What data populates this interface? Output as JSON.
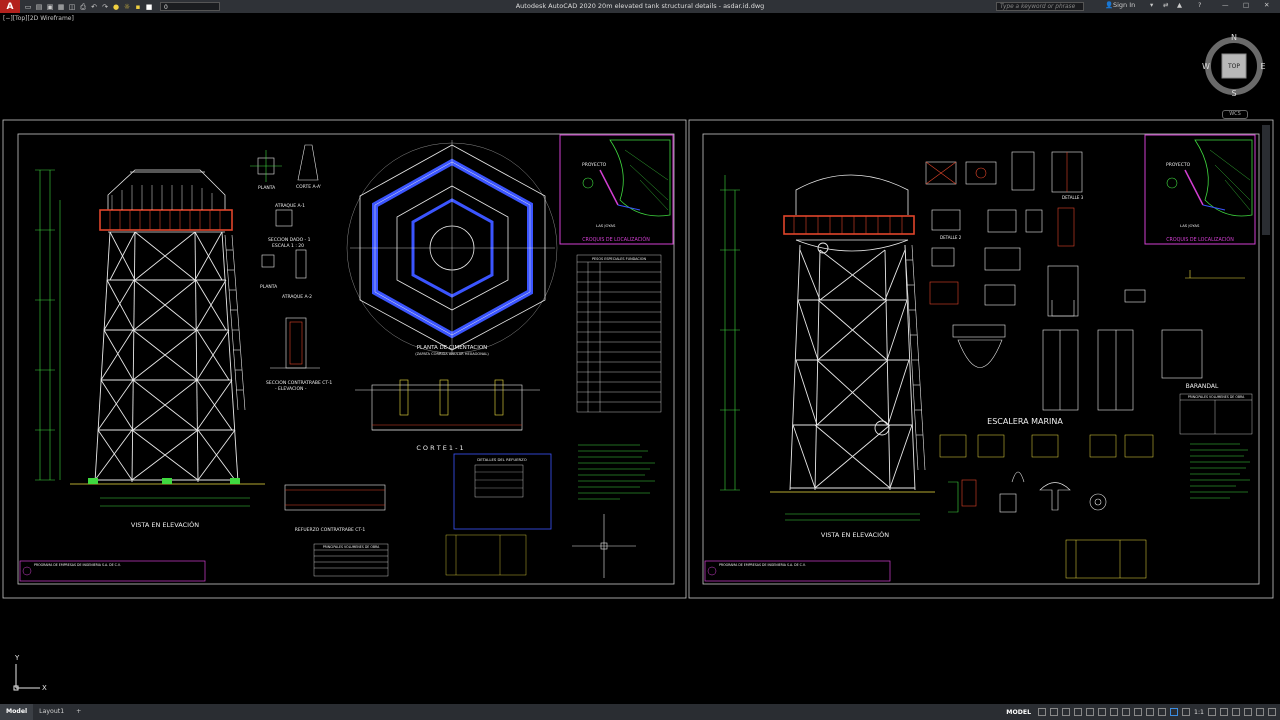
{
  "app": {
    "logo_letter": "A",
    "title": "Autodesk AutoCAD 2020   20m elevated tank structural details - asdar.id.dwg",
    "search_placeholder": "Type a keyword or phrase",
    "sign_in": "Sign In",
    "layer_value": "0",
    "window_controls": [
      "—",
      "□",
      "✕"
    ]
  },
  "viewport": {
    "label": "[−][Top][2D Wireframe]"
  },
  "viewcube": {
    "north": "N",
    "south": "S",
    "east": "E",
    "west": "W",
    "face": "TOP",
    "wcs": "WCS"
  },
  "ucs": {
    "x": "X",
    "y": "Y"
  },
  "status": {
    "tabs": [
      "Model",
      "Layout1"
    ],
    "add_tab": "+",
    "mode": "MODEL",
    "scale": "1:1"
  },
  "sheet1": {
    "elevation_title": "VISTA EN ELEVACIÓN",
    "foundation_title": "PLANTA DE CIMENTACION",
    "foundation_sub": "(ZAPATA CORRIDA ANULAR HEXAGONAL)",
    "cut_title": "C O R T E   1 - 1",
    "location_title": "CROQUIS DE LOCALIZACIÓN",
    "project_label": "PROYECTO",
    "place_label": "LAS JOYAS",
    "plan_label": "PLANTA",
    "cut_aa": "CORTE A-A'",
    "atraque": "ATRAQUE A-1",
    "seccion_dado": "SECCION DADO - 1",
    "escala": "ESCALA 1 : 20",
    "planta2": "PLANTA",
    "atraque2": "ATRAQUE A-2",
    "seccion_contratrabe": "SECCION CONTRATRABE CT-1",
    "elevacion": "- ELEVACION -",
    "refuerzo": "REFUERZO CONTRATRABE CT-1",
    "detalle_refuerzo": "DETALLES DEL REFUERZO",
    "pesos_title": "PESOS ESPECIALES FUNDACION",
    "volumenes_title": "PRINCIPALES VOLUMENES DE OBRA",
    "company": "PROGRAMA DE EMPRESAS DE INGENIERIA S.A. DE C.V."
  },
  "sheet2": {
    "elevation_title": "VISTA EN ELEVACIÓN",
    "escalera": "ESCALERA  MARINA",
    "barandal": "BARANDAL",
    "location_title": "CROQUIS DE LOCALIZACIÓN",
    "project_label": "PROYECTO",
    "place_label": "LAS JOYAS",
    "detalle2": "DETALLE 2",
    "detalle3": "DETALLE 3",
    "volumenes_title": "PRINCIPALES VOLUMENES DE OBRA",
    "company": "PROGRAMA DE EMPRESAS DE INGENIERIA S.A. DE C.V."
  },
  "colors": {
    "background": "#000000",
    "frame": "#c8c8c8",
    "structure": "#e8e8e8",
    "tank_band": "#e0452a",
    "dimension": "#3fd93f",
    "text_yellow": "#f0e040",
    "magenta": "#d23fd2",
    "blue": "#3b55ff",
    "cyan": "#3fd9e0"
  }
}
